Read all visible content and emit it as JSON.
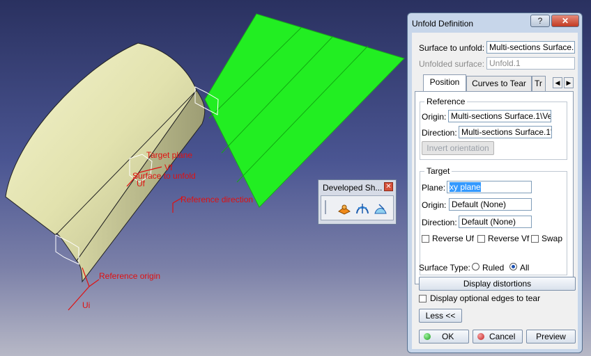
{
  "viewport": {
    "annotations": {
      "target_plane": "Target plane",
      "vf": "Vf",
      "surface_to_unfold": "Surface to unfold",
      "uf": "Uf",
      "reference_direction": "Reference direction",
      "reference_origin": "Reference origin",
      "ui": "Ui"
    }
  },
  "toolbar": {
    "title": "Developed Sh...",
    "tools": [
      "unfold-icon",
      "develop-icon",
      "transfer-icon"
    ]
  },
  "dialog": {
    "title": "Unfold Definition",
    "help_label": "?",
    "close_label": "✕",
    "surface_to_unfold_label": "Surface to unfold:",
    "surface_to_unfold_value": "Multi-sections Surface.",
    "unfolded_surface_label": "Unfolded surface:",
    "unfolded_surface_value": "Unfold.1",
    "tabs": [
      "Position",
      "Curves to Tear",
      "Tr"
    ],
    "active_tab": "Position",
    "reference": {
      "title": "Reference",
      "origin_label": "Origin:",
      "origin_value": "Multi-sections Surface.1\\Ve",
      "direction_label": "Direction:",
      "direction_value": "Multi-sections Surface.1'",
      "invert_label": "Invert orientation"
    },
    "target": {
      "title": "Target",
      "plane_label": "Plane:",
      "plane_value": "xy plane",
      "origin_label": "Origin:",
      "origin_value": "Default (None)",
      "direction_label": "Direction:",
      "direction_value": "Default (None)",
      "reverse_uf_label": "Reverse Uf",
      "reverse_vf_label": "Reverse Vf",
      "swap_label": "Swap"
    },
    "surface_type_label": "Surface Type:",
    "ruled_label": "Ruled",
    "all_label": "All",
    "display_distortions_label": "Display distortions",
    "display_optional_edges_label": "Display optional edges to tear",
    "less_label": "Less <<",
    "ok_label": "OK",
    "cancel_label": "Cancel",
    "preview_label": "Preview"
  },
  "colors": {
    "green_surface": "#22ee22",
    "beige_surface": "#e6e6b4",
    "annotation_red": "#e01010",
    "dialog_frame": "#c7d6ea"
  }
}
